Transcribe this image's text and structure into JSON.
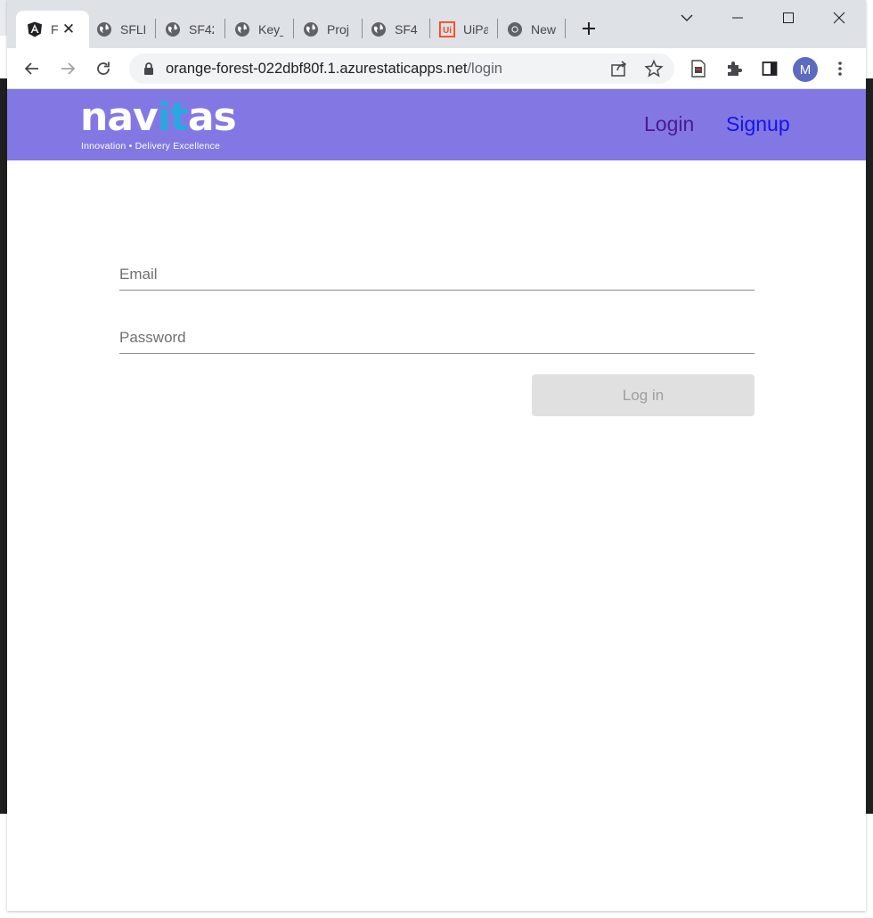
{
  "browser": {
    "tabs": [
      {
        "title": "F",
        "icon": "angular-icon",
        "active": true
      },
      {
        "title": "SFLL",
        "icon": "globe-icon"
      },
      {
        "title": "SF42",
        "icon": "globe-icon"
      },
      {
        "title": "Key_",
        "icon": "globe-icon"
      },
      {
        "title": "Proj",
        "icon": "globe-icon"
      },
      {
        "title": "SF4",
        "icon": "globe-icon"
      },
      {
        "title": "UiPa",
        "icon": "uipath-icon"
      },
      {
        "title": "New",
        "icon": "chrome-icon"
      }
    ],
    "url_host": "orange-forest-022dbf80f.1.azurestaticapps.net",
    "url_path": "/login",
    "profile_initial": "M"
  },
  "site": {
    "logo_text": "navitas",
    "logo_tagline": "Innovation • Delivery Excellence",
    "nav": {
      "login_label": "Login",
      "signup_label": "Signup"
    },
    "colors": {
      "header_bg": "#8377e4",
      "login_link": "#4a1a8e",
      "signup_link": "#1515e6",
      "logo_accent": "#29a8e0"
    }
  },
  "form": {
    "email_placeholder": "Email",
    "email_value": "",
    "password_placeholder": "Password",
    "password_value": "",
    "submit_label": "Log in",
    "submit_disabled": true
  }
}
